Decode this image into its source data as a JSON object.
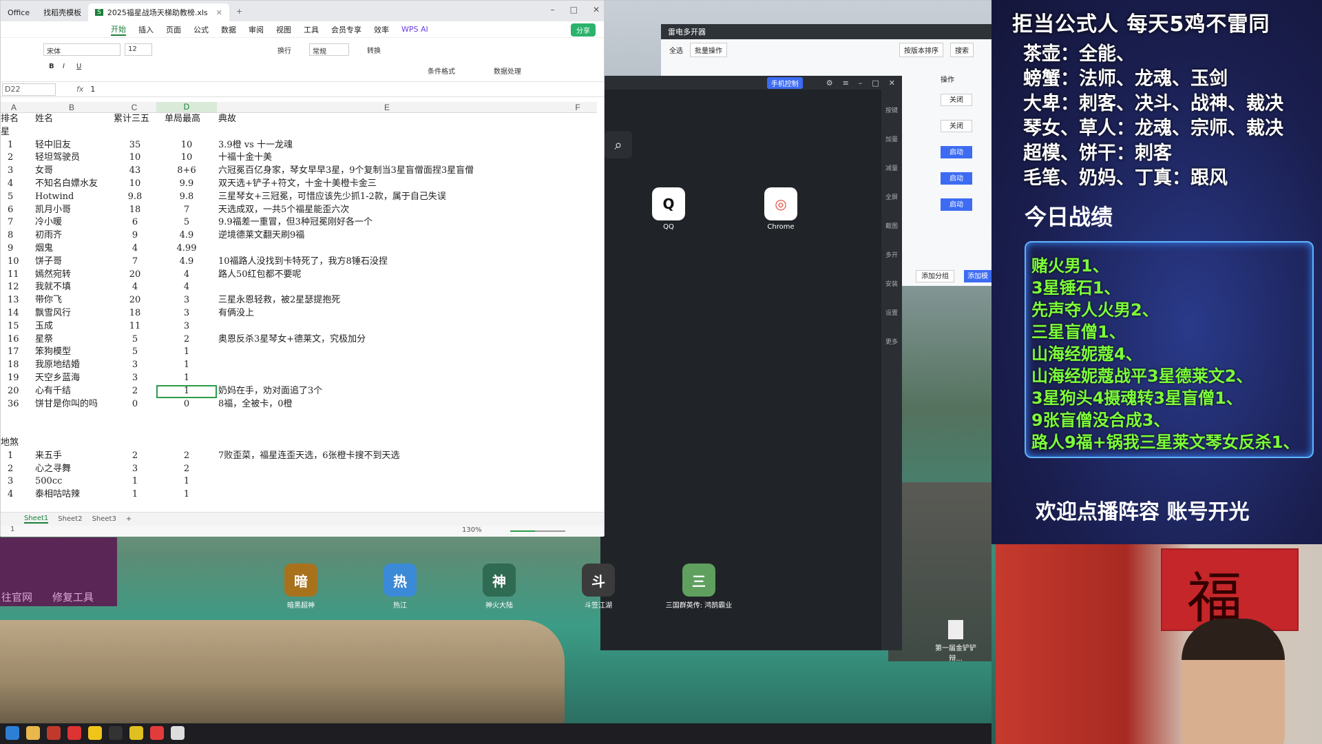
{
  "spreadsheet": {
    "tabs": [
      "Office",
      "找稻壳模板",
      "2025福星战场天梯助教榜.xls"
    ],
    "menu": [
      "开始",
      "插入",
      "页面",
      "公式",
      "数据",
      "审阅",
      "视图",
      "工具",
      "会员专享",
      "效率",
      "WPS AI"
    ],
    "active_menu": "开始",
    "share_label": "分享",
    "font_name": "宋体",
    "font_size": "12",
    "number_format": "常规",
    "ribbon_labels": {
      "wrap": "换行",
      "convert": "转换",
      "cond_format": "条件格式",
      "data_process": "数据处理"
    },
    "cell_ref": "D22",
    "formula_value": "1",
    "columns": [
      "A",
      "B",
      "C",
      "D",
      "E",
      "F"
    ],
    "header": {
      "a": "排名",
      "b": "姓名",
      "c": "累计三五",
      "d": "单局最高",
      "e": "典故"
    },
    "label_row": "星",
    "rows": [
      {
        "a": "1",
        "b": "轻中旧友",
        "c": "35",
        "d": "10",
        "e": "3.9橙 vs 十一龙魂"
      },
      {
        "a": "2",
        "b": "轻坦驾驶员",
        "c": "10",
        "d": "10",
        "e": "十福十金十美"
      },
      {
        "a": "3",
        "b": "女哥",
        "c": "43",
        "d": "8+6",
        "e": "六冠冕百亿身家，琴女早早3星，9个复制当3星盲僧面捏3星盲僧"
      },
      {
        "a": "4",
        "b": "不知名白嫖水友",
        "c": "10",
        "d": "9.9",
        "e": "双天选+铲子+符文，十金十美橙卡金三"
      },
      {
        "a": "5",
        "b": "Hotwind",
        "c": "9.8",
        "d": "9.8",
        "e": "三星琴女+三冠冕，可惜应该先少抓1-2款，属于自己失误"
      },
      {
        "a": "6",
        "b": "凯月小哥",
        "c": "18",
        "d": "7",
        "e": "天选成双，一共5个福星能歪六次"
      },
      {
        "a": "7",
        "b": "冷小暖",
        "c": "6",
        "d": "5",
        "e": "9.9福差一重冒，但3种冠冕刚好各一个"
      },
      {
        "a": "8",
        "b": "初雨齐",
        "c": "9",
        "d": "4.9",
        "e": "逆境德莱文翻天刷9福"
      },
      {
        "a": "9",
        "b": "烟鬼",
        "c": "4",
        "d": "4.99",
        "e": ""
      },
      {
        "a": "10",
        "b": "饼子哥",
        "c": "7",
        "d": "4.9",
        "e": "10福路人没找到卡特死了，我方8锤石没捏"
      },
      {
        "a": "11",
        "b": "嫣然宛转",
        "c": "20",
        "d": "4",
        "e": "路人50红包都不要呢"
      },
      {
        "a": "12",
        "b": "我就不填",
        "c": "4",
        "d": "4",
        "e": ""
      },
      {
        "a": "13",
        "b": "带你飞",
        "c": "20",
        "d": "3",
        "e": "三星永恩轻救，被2星瑟提抱死"
      },
      {
        "a": "14",
        "b": "飘雪风行",
        "c": "18",
        "d": "3",
        "e": "有俩没上"
      },
      {
        "a": "15",
        "b": "玉成",
        "c": "11",
        "d": "3",
        "e": ""
      },
      {
        "a": "16",
        "b": "星祭",
        "c": "5",
        "d": "2",
        "e": "奥恩反杀3星琴女+德莱文，究极加分"
      },
      {
        "a": "17",
        "b": "笨狗模型",
        "c": "5",
        "d": "1",
        "e": ""
      },
      {
        "a": "18",
        "b": "我原地结婚",
        "c": "3",
        "d": "1",
        "e": ""
      },
      {
        "a": "19",
        "b": "天空乡蓝海",
        "c": "3",
        "d": "1",
        "e": ""
      },
      {
        "a": "20",
        "b": "心有千结",
        "c": "2",
        "d": "1",
        "e": "奶妈在手，劝对面追了3个"
      },
      {
        "a": "36",
        "b": "饼甘是你叫的吗",
        "c": "0",
        "d": "0",
        "e": "8福，全被卡，0橙"
      }
    ],
    "section2_label": "地煞",
    "rows2": [
      {
        "a": "1",
        "b": "来五手",
        "c": "2",
        "d": "2",
        "e": "7败歪菜，福星连歪天选，6张橙卡搜不到天选"
      },
      {
        "a": "2",
        "b": "心之寻舞",
        "c": "3",
        "d": "2",
        "e": ""
      },
      {
        "a": "3",
        "b": "500cc",
        "c": "1",
        "d": "1",
        "e": ""
      },
      {
        "a": "4",
        "b": "泰相咕咕辣",
        "c": "1",
        "d": "1",
        "e": ""
      }
    ],
    "sheets": [
      "Sheet1",
      "Sheet2",
      "Sheet3"
    ],
    "active_sheet": "Sheet1",
    "status_page": "1",
    "zoom": "130%",
    "zoom_fraction": 0.45
  },
  "emulator": {
    "badge": "手机控制",
    "side_labels": [
      "按键",
      "加量",
      "减量",
      "全屏",
      "截图",
      "多开",
      "安装",
      "设置",
      "更多"
    ],
    "apps_top": [
      {
        "label": "QQ",
        "glyph": "Q",
        "color": "#111111"
      },
      {
        "label": "Chrome",
        "glyph": "◎",
        "color": "#e8453c"
      }
    ],
    "apps_bottom": [
      {
        "label": "暗黑超神",
        "glyph": "暗",
        "color": "#a8721d"
      },
      {
        "label": "热江",
        "glyph": "热",
        "color": "#3b8ad8"
      },
      {
        "label": "神火大陆",
        "glyph": "神",
        "color": "#2f6a52"
      },
      {
        "label": "斗笠江湖",
        "glyph": "斗",
        "color": "#3b3b3b"
      },
      {
        "label": "三国群英传: 鸿鹄霸业",
        "glyph": "三",
        "color": "#5fa05f"
      }
    ]
  },
  "multi_opener": {
    "title": "雷电多开器",
    "select_all": "全选",
    "batch": "批量操作",
    "sort": "按版本排序",
    "search_placeholder": "搜索",
    "op_header": "操作",
    "buttons": [
      "关闭",
      "关闭",
      "启动",
      "启动",
      "启动"
    ],
    "add_group": "添加分组",
    "add_emulator": "添加模"
  },
  "desktop": {
    "purple_links": [
      "往官网",
      "修复工具"
    ],
    "file_label": "第一届金铲铲辩..."
  },
  "overlay": {
    "heading": "拒当公式人  每天5鸡不雷同",
    "lines": [
      "茶壶：全能、",
      "螃蟹：法师、龙魂、玉剑",
      "大卑：刺客、决斗、战神、裁决",
      "琴女、草人：龙魂、宗师、裁决",
      "超模、饼干：刺客",
      "毛笔、奶妈、丁真：跟风"
    ],
    "record_title": "今日战绩",
    "records": [
      "赌火男1、",
      "3星锤石1、",
      "先声夺人火男2、",
      "三星盲僧1、",
      "山海经妮蔻4、",
      "山海经妮蔻战平3星德莱文2、",
      "3星狗头4摄魂转3星盲僧1、",
      "9张盲僧没合成3、",
      "路人9福+锅我三星莱文琴女反杀1、"
    ],
    "footer": "欢迎点播阵容  账号开光",
    "webcam_char": "福"
  }
}
